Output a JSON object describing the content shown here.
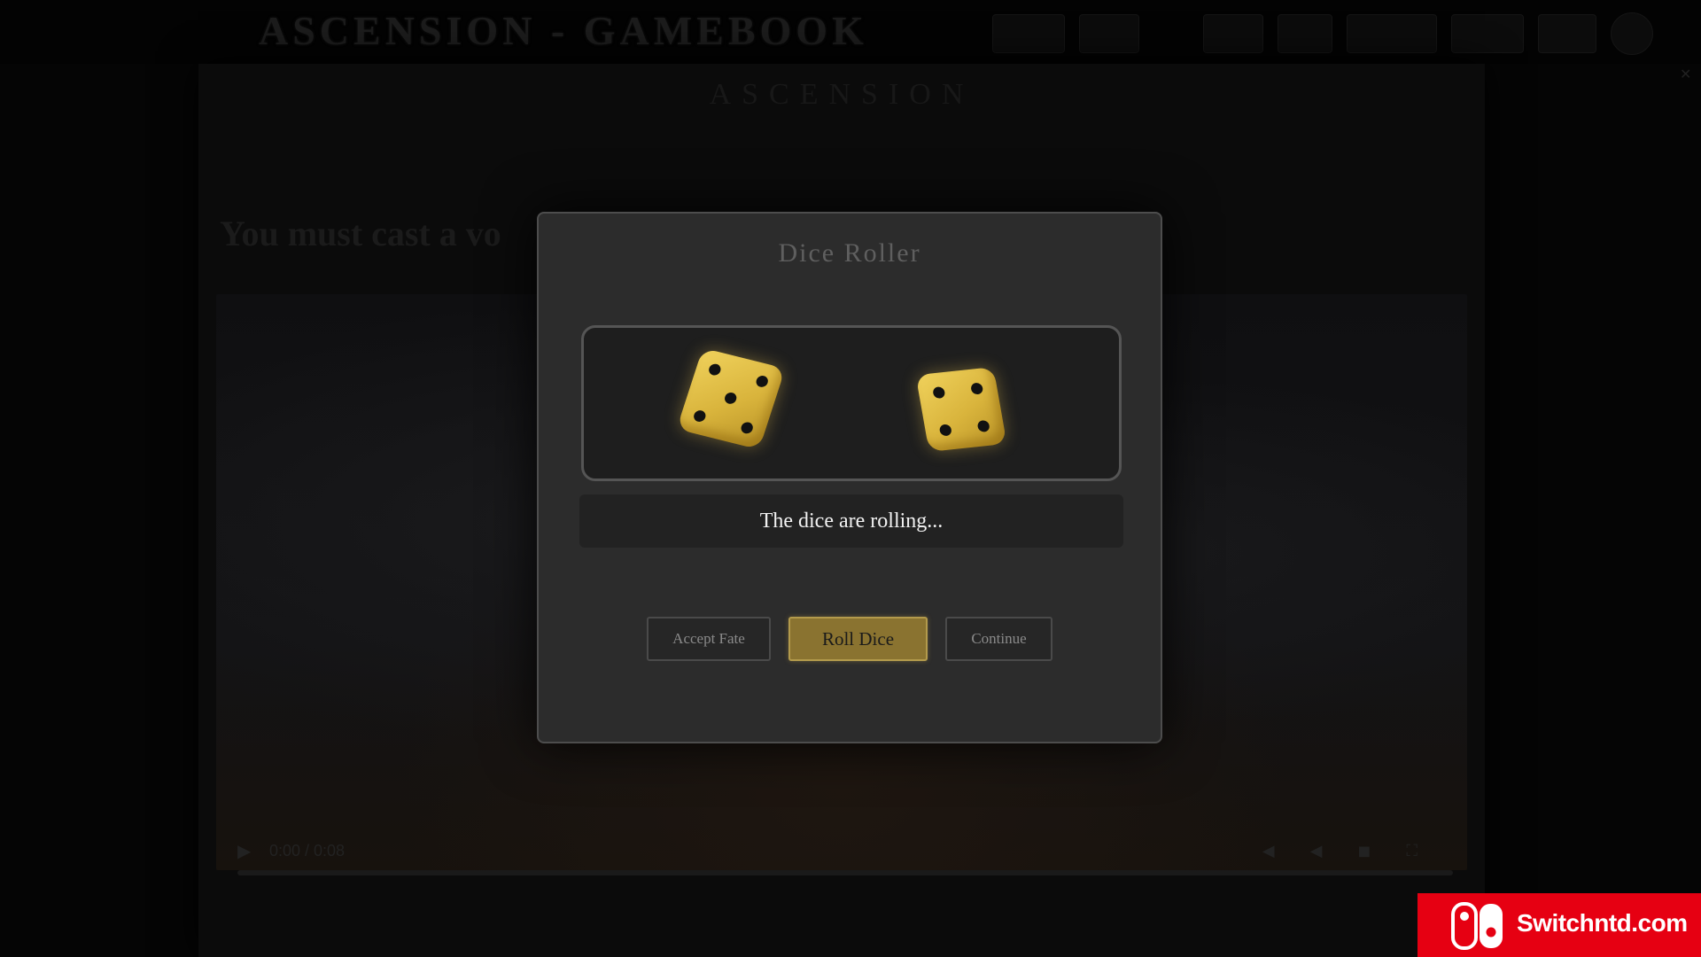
{
  "app": {
    "title": "ASCENSION - GAMEBOOK"
  },
  "book": {
    "header": "ASCENSION",
    "scene_text": "You must cast a vo",
    "video_time": "0:00 / 0:08"
  },
  "modal": {
    "title": "Dice Roller",
    "status": "The dice are rolling...",
    "buttons": {
      "accept": "Accept Fate",
      "roll": "Roll Dice",
      "continue": "Continue"
    },
    "dice": [
      {
        "face": 5,
        "color": "#e2c04a"
      },
      {
        "face": 4,
        "color": "#e2c04a"
      }
    ],
    "colors": {
      "accent": "#8a7330",
      "panel": "#2c2c2c"
    }
  },
  "watermark": {
    "text": "Switchntd.com",
    "color": "#e60012"
  }
}
